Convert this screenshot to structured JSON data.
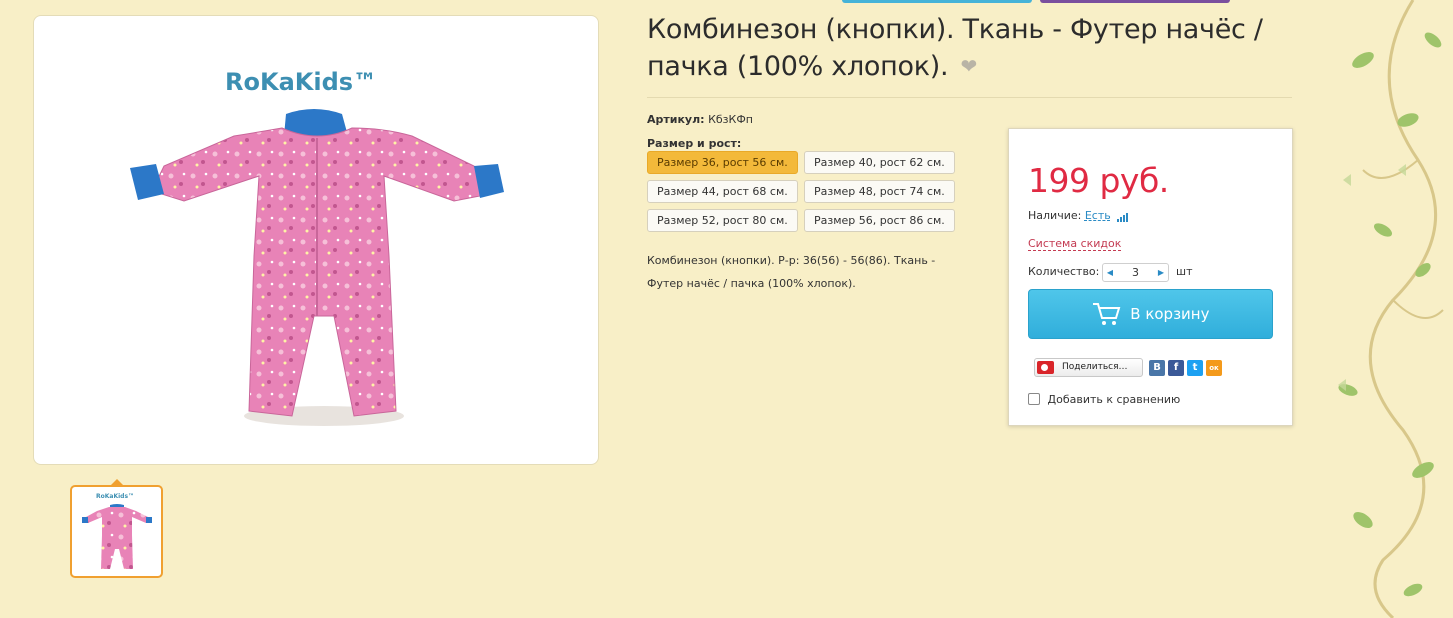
{
  "product": {
    "title": "Комбинезон (кнопки). Ткань - Футер начёс / пачка (100% хлопок).",
    "article_label": "Артикул:",
    "article_value": "КбзКФп",
    "size_label": "Размер и рост:",
    "sizes": [
      "Размер 36, рост 56 см.",
      "Размер 40, рост 62 см.",
      "Размер 44, рост 68 см.",
      "Размер 48, рост 74 см.",
      "Размер 52, рост 80 см.",
      "Размер 56, рост 86 см."
    ],
    "selected_size": "Размер 36, рост 56 см.",
    "description_line1": "Комбинезон (кнопки). Р-р: 36(56) - 56(86). Ткань -",
    "description_line2": "Футер начёс / пачка (100% хлопок).",
    "brand_logo": "RoKaKids™",
    "thumb_logo": "RoKaKids™",
    "image_icon": "pink-romper-image"
  },
  "buybox": {
    "price": "199 руб.",
    "availability_label": "Наличие:",
    "availability_value": "Есть",
    "discount_link": "Система скидок",
    "quantity_label": "Количество:",
    "quantity_value": "3",
    "quantity_unit": "шт",
    "cart_button": "В корзину",
    "share_button": "Поделиться…",
    "social": [
      "В",
      "f",
      "t",
      "ок"
    ],
    "compare_label": "Добавить к сравнению"
  },
  "colors": {
    "background": "#f8efc7",
    "accent_blue": "#30aedb",
    "price_red": "#e02a43",
    "active_size": "#f3b93a"
  }
}
